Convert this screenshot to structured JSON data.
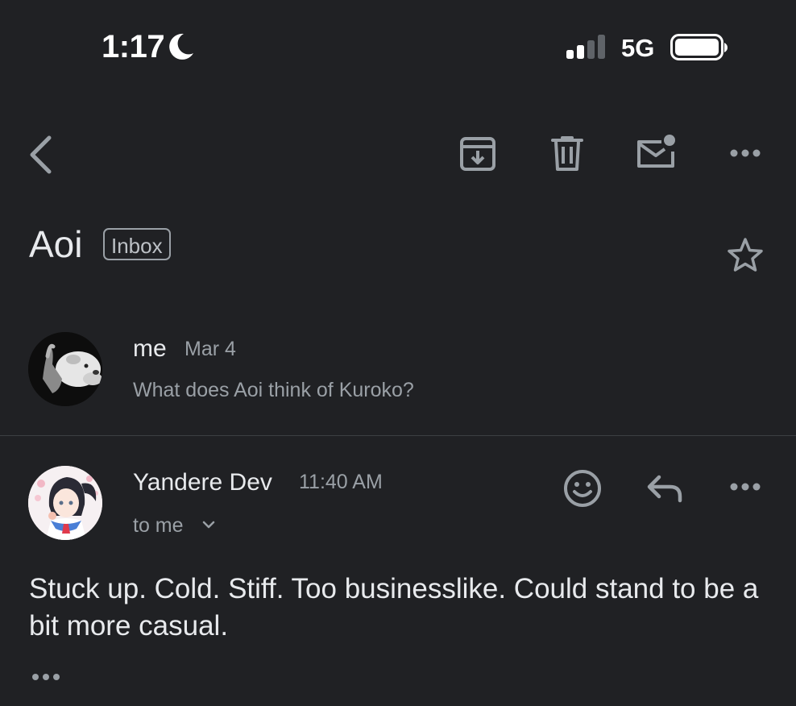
{
  "status_bar": {
    "time": "1:17",
    "network": "5G",
    "icons": [
      "moon-icon",
      "signal-icon",
      "battery-icon"
    ]
  },
  "toolbar": {
    "icons": [
      "back-icon",
      "archive-icon",
      "trash-icon",
      "mark-unread-icon",
      "more-icon"
    ]
  },
  "thread": {
    "subject": "Aoi",
    "label": "Inbox"
  },
  "messages": [
    {
      "sender": "me",
      "date": "Mar 4",
      "snippet": "What does Aoi think of Kuroko?"
    },
    {
      "sender": "Yandere Dev",
      "time": "11:40 AM",
      "recipient": "to me",
      "body": "Stuck up. Cold. Stiff. Too businesslike. Could stand to be a bit more casual."
    }
  ],
  "colors": {
    "background": "#202124",
    "text_primary": "#e8eaed",
    "text_secondary": "#9aa0a6",
    "icon": "#9aa0a6"
  }
}
